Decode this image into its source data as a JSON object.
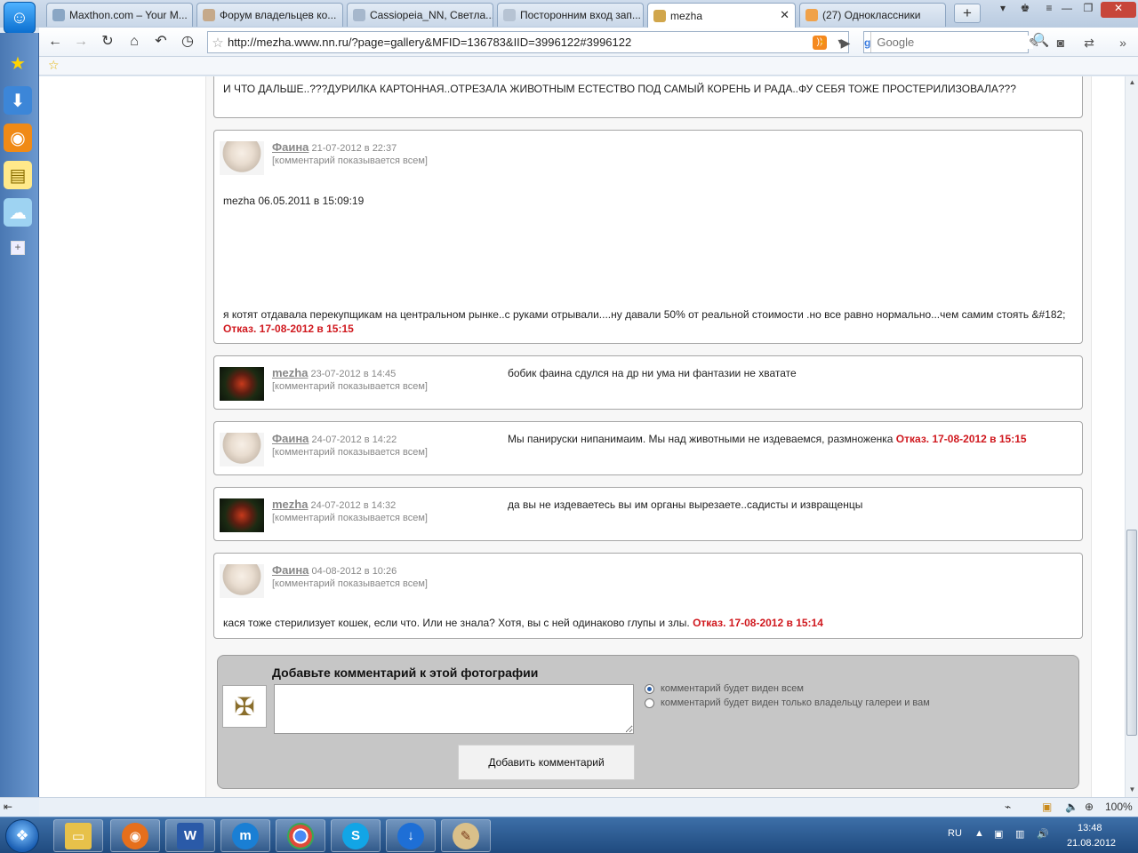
{
  "browser": {
    "tabs": [
      {
        "label": "Maxthon.com – Your M...",
        "fav_color": "#8aa6c4"
      },
      {
        "label": "Форум владельцев ко...",
        "fav_color": "#c5a98a"
      },
      {
        "label": "Cassiopeia_NN, Светла...",
        "fav_color": "#a6b7cc"
      },
      {
        "label": "Посторонним вход зап...",
        "fav_color": "#b6c3d3"
      },
      {
        "label": "mezha",
        "fav_color": "#d1a64b"
      },
      {
        "label": "(27) Одноклассники",
        "fav_color": "#f0a24a"
      }
    ],
    "new_tab_label": "+",
    "url": "http://mezha.www.nn.ru/?page=gallery&MFID=136783&IID=3996122#3996122",
    "search_engine": "g",
    "search_placeholder": "Google",
    "zoom": "100%"
  },
  "top_text": "И ЧТО ДАЛЬШЕ..???ДУРИЛКА КАРТОННАЯ..ОТРЕЗАЛА ЖИВОТНЫМ ЕСТЕСТВО ПОД САМЫЙ КОРЕНЬ И РАДА..ФУ СЕБЯ ТОЖЕ ПРОСТЕРИЛИЗОВАЛА???",
  "comments": [
    {
      "author": "Фаина",
      "date": "21-07-2012 в 22:37",
      "visibility": "[комментарий показывается всем]",
      "quote_line": "mezha 06.05.2011 в 15:09:19",
      "text": "я котят отдавала перекупщикам на центральном рынке..с руками отрывали....ну давали 50% от реальной стоимости .но все равно нормально...чем самим стоять &#182;",
      "refusal": "Отказ. 17-08-2012 в 15:15"
    },
    {
      "author": "mezha",
      "date": "23-07-2012 в 14:45",
      "visibility": "[комментарий показывается всем]",
      "text": "бобик фаина сдулся на др ни ума ни фантазии не хватате"
    },
    {
      "author": "Фаина",
      "date": "24-07-2012 в 14:22",
      "visibility": "[комментарий показывается всем]",
      "text": "Мы панируски нипанимаим. Мы над животными не издеваемся, размноженка",
      "refusal": "Отказ. 17-08-2012 в 15:15"
    },
    {
      "author": "mezha",
      "date": "24-07-2012 в 14:32",
      "visibility": "[комментарий показывается всем]",
      "text": "да вы не издеваетесь вы им органы вырезаете..садисты и извращенцы"
    },
    {
      "author": "Фаина",
      "date": "04-08-2012 в 10:26",
      "visibility": "[комментарий показывается всем]",
      "text": "кася тоже стерилизует кошек, если что. Или не знала? Хотя, вы с ней одинаково глупы и злы.",
      "refusal": "Отказ. 17-08-2012 в 15:14"
    }
  ],
  "comment_form": {
    "title": "Добавьте комментарий к этой фотографии",
    "option_all": "комментарий будет виден всем",
    "option_owner": "комментарий будет виден только владельцу галереи и вам",
    "selected": "all",
    "submit_label": "Добавить комментарий"
  },
  "taskbar": {
    "lang": "RU",
    "time": "13:48",
    "date": "21.08.2012"
  }
}
